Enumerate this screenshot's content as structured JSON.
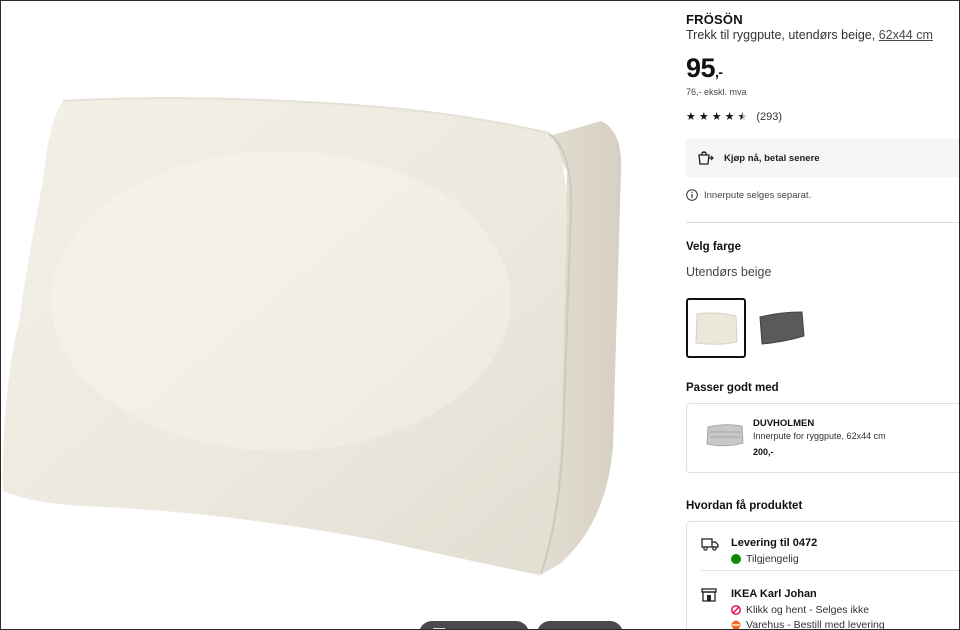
{
  "product": {
    "brand": "FRÖSÖN",
    "description": "Trekk til ryggpute, utendørs beige,",
    "size_link": "62x44 cm",
    "price_main": "95",
    "price_dec": ",-",
    "price_ex_vat": "76,- ekskl. mva",
    "rating": 4.5,
    "review_count": "(293)"
  },
  "bnpl": {
    "label": "Kjøp nå, betal senere",
    "icon": "shopping-bag-icon"
  },
  "note": {
    "label": "Innerpute selges separat.",
    "icon": "info-icon"
  },
  "color": {
    "heading": "Velg farge",
    "selected_name": "Utendørs beige",
    "swatches": [
      {
        "name": "beige",
        "color": "#ece7db"
      },
      {
        "name": "dark-grey",
        "color": "#5a5a5a"
      }
    ]
  },
  "pairs": {
    "heading": "Passer godt med",
    "item": {
      "name": "DUVHOLMEN",
      "subtitle": "Innerpute for ryggpute, 62x44 cm",
      "price": "200,-"
    }
  },
  "fulfilment": {
    "heading": "Hvordan få produktet",
    "delivery": {
      "title": "Levering til 0472",
      "status": "Tilgjengelig",
      "status_color": "#0a8a00"
    },
    "store": {
      "title": "IKEA Karl Johan",
      "click_collect": "Klikk og hent - Selges ikke",
      "warehouse": "Varehus - Bestill med levering",
      "no_color": "#e00751",
      "warehouse_color": "#f26a1b"
    }
  },
  "colors": {
    "text": "#111111",
    "accent": "#0058a3"
  }
}
